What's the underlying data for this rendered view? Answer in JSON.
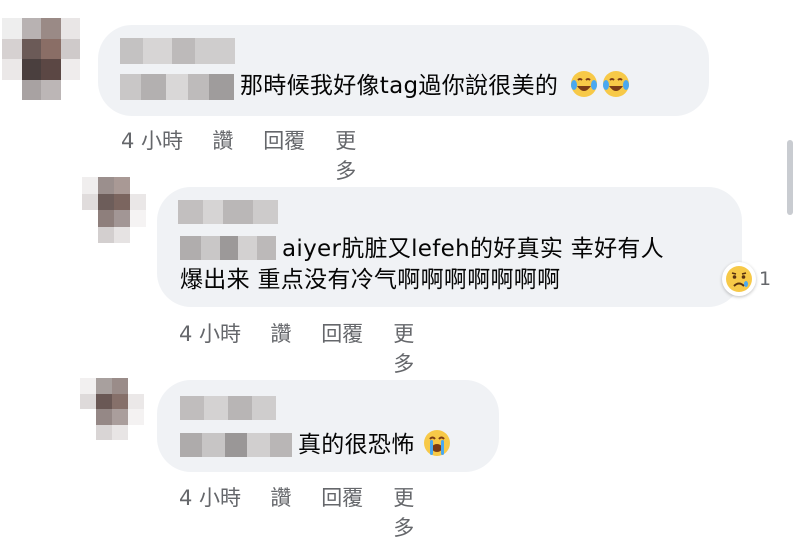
{
  "comments": [
    {
      "text_prefix": "",
      "lines": [
        "那時候我好像tag過你說很美的"
      ],
      "emoji": [
        "tears-of-joy-icon",
        "tears-of-joy-icon"
      ],
      "actions": {
        "time": "4 小時",
        "like": "讚",
        "reply": "回覆",
        "more": "更多"
      }
    },
    {
      "lines": [
        "aiyer肮脏又lefeh的好真实 幸好有人",
        "爆出来 重点没有冷气啊啊啊啊啊啊啊"
      ],
      "reaction": {
        "icon": "sad-face-icon",
        "count": "1"
      },
      "actions": {
        "time": "4 小時",
        "like": "讚",
        "reply": "回覆",
        "more": "更多"
      }
    },
    {
      "lines": [
        "真的很恐怖"
      ],
      "emoji": [
        "loudly-crying-icon"
      ],
      "actions": {
        "time": "4 小時",
        "like": "讚",
        "reply": "回覆",
        "more": "更多"
      }
    }
  ],
  "colors": {
    "bubble": "#f0f2f5",
    "meta_text": "#65676b",
    "body_text": "#050505"
  }
}
